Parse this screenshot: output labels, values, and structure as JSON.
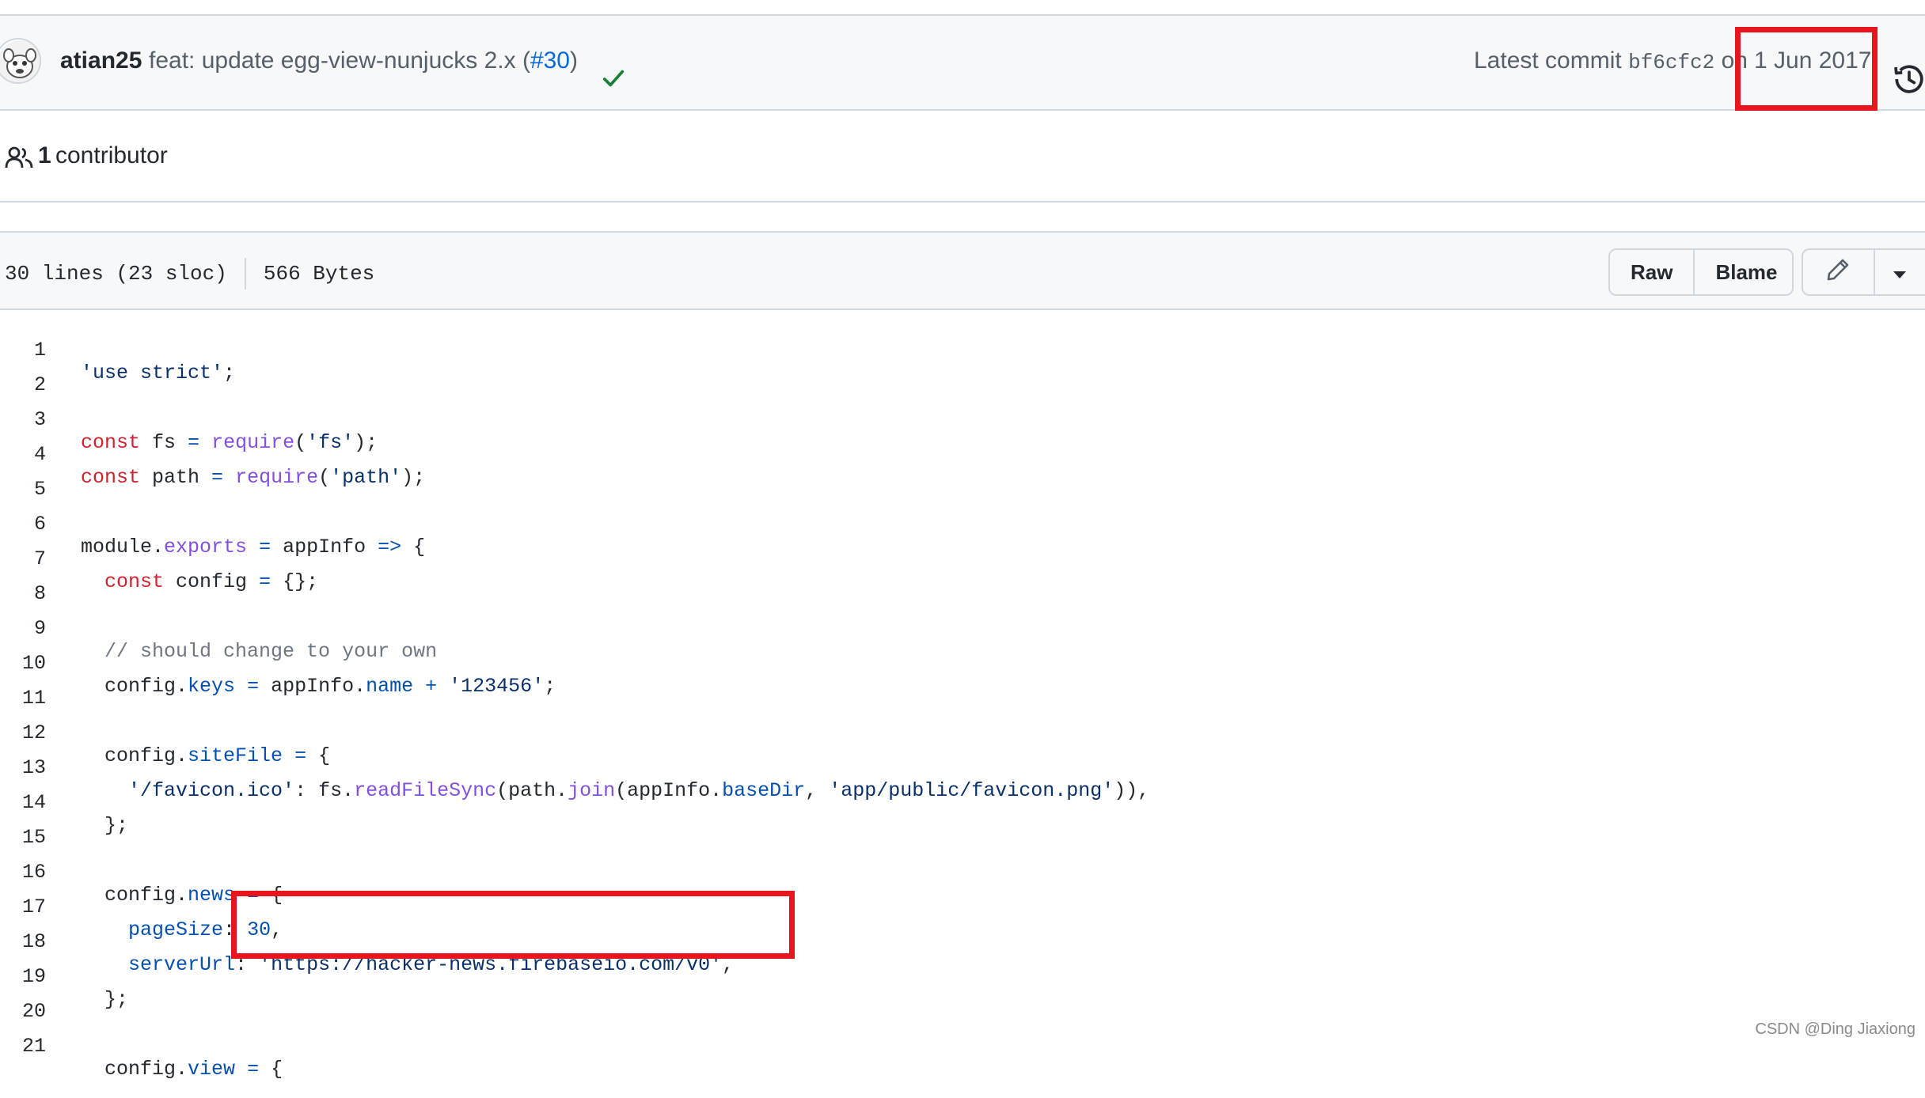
{
  "commit": {
    "author": "atian25",
    "message": "feat: update egg-view-nunjucks 2.x (",
    "pr_link": "#30",
    "message_end": ")",
    "latest_label": "Latest commit ",
    "sha": "bf6cfc2",
    "on_label": " on",
    "date": "1 Jun 2017",
    "status_color": "#1a7f37"
  },
  "contributors": {
    "count": "1",
    "label": " contributor"
  },
  "file": {
    "lines": "30 lines (23 sloc)",
    "size": "566 Bytes",
    "raw_label": "Raw",
    "blame_label": "Blame"
  },
  "icons": {
    "avatar": "avatar-image",
    "check": "check-icon",
    "history": "history-icon",
    "people": "people-icon",
    "edit": "pencil-icon",
    "dropdown": "triangle-down-icon"
  },
  "code": {
    "line_numbers": [
      "1",
      "2",
      "3",
      "4",
      "5",
      "6",
      "7",
      "8",
      "9",
      "10",
      "11",
      "12",
      "13",
      "14",
      "15",
      "16",
      "17",
      "18",
      "19",
      "20",
      "21"
    ]
  },
  "watermark": "CSDN @Ding Jiaxiong",
  "annotation_color": "#e8151e"
}
